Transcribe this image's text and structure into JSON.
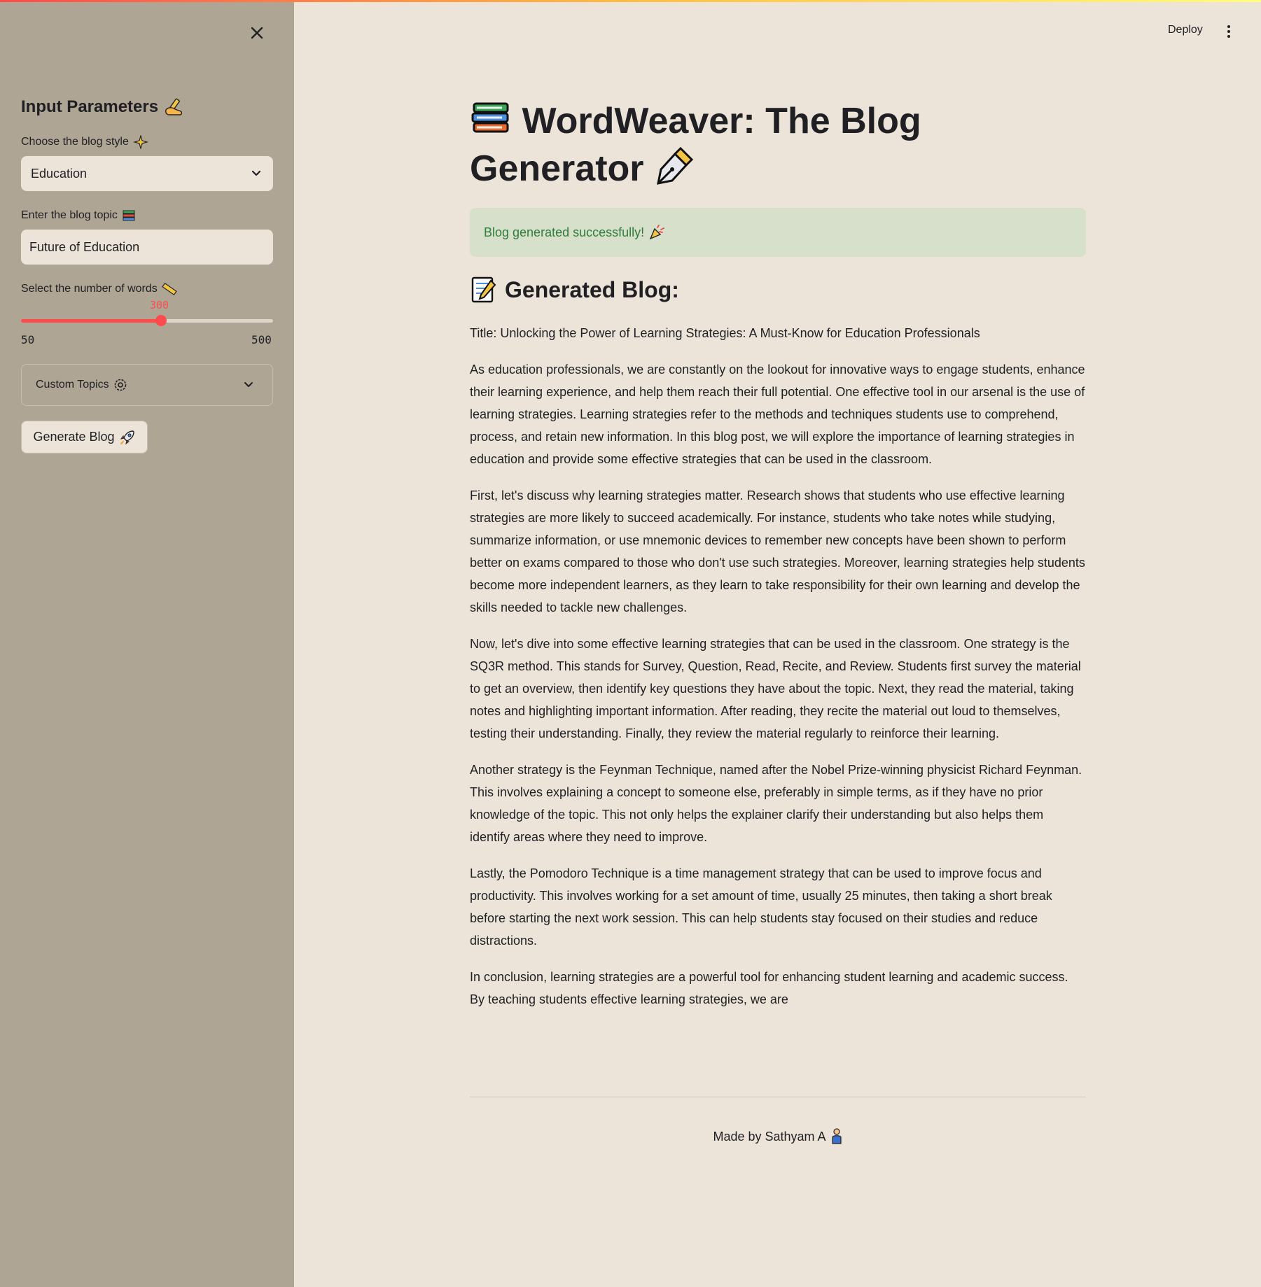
{
  "sidebar": {
    "title": "Input Parameters",
    "style_label": "Choose the blog style",
    "style_value": "Education",
    "topic_label": "Enter the blog topic",
    "topic_value": "Future of Education",
    "words_label": "Select the number of words",
    "words_value": "300",
    "words_min": "50",
    "words_max": "500",
    "custom_topics_label": "Custom Topics",
    "generate_label": "Generate Blog"
  },
  "header": {
    "deploy_label": "Deploy"
  },
  "main": {
    "title_part1": "WordWeaver: The Blog",
    "title_part2": "Generator",
    "success_message": "Blog generated successfully!",
    "section_heading": "Generated Blog:",
    "blog_title": "Title: Unlocking the Power of Learning Strategies: A Must-Know for Education Professionals",
    "paragraphs": [
      "As education professionals, we are constantly on the lookout for innovative ways to engage students, enhance their learning experience, and help them reach their full potential. One effective tool in our arsenal is the use of learning strategies. Learning strategies refer to the methods and techniques students use to comprehend, process, and retain new information. In this blog post, we will explore the importance of learning strategies in education and provide some effective strategies that can be used in the classroom.",
      "First, let's discuss why learning strategies matter. Research shows that students who use effective learning strategies are more likely to succeed academically. For instance, students who take notes while studying, summarize information, or use mnemonic devices to remember new concepts have been shown to perform better on exams compared to those who don't use such strategies. Moreover, learning strategies help students become more independent learners, as they learn to take responsibility for their own learning and develop the skills needed to tackle new challenges.",
      "Now, let's dive into some effective learning strategies that can be used in the classroom. One strategy is the SQ3R method. This stands for Survey, Question, Read, Recite, and Review. Students first survey the material to get an overview, then identify key questions they have about the topic. Next, they read the material, taking notes and highlighting important information. After reading, they recite the material out loud to themselves, testing their understanding. Finally, they review the material regularly to reinforce their learning.",
      "Another strategy is the Feynman Technique, named after the Nobel Prize-winning physicist Richard Feynman. This involves explaining a concept to someone else, preferably in simple terms, as if they have no prior knowledge of the topic. This not only helps the explainer clarify their understanding but also helps them identify areas where they need to improve.",
      "Lastly, the Pomodoro Technique is a time management strategy that can be used to improve focus and productivity. This involves working for a set amount of time, usually 25 minutes, then taking a short break before starting the next work session. This can help students stay focused on their studies and reduce distractions.",
      "In conclusion, learning strategies are a powerful tool for enhancing student learning and academic success. By teaching students effective learning strategies, we are"
    ],
    "footer_text": "Made by Sathyam A"
  },
  "colors": {
    "accent": "#ff4b4b",
    "sidebar_bg": "#aea594",
    "main_bg": "#ece4d8",
    "success_bg": "#d6e0cb",
    "success_text": "#2f7d3a"
  },
  "icons": {
    "close": "close-icon",
    "menu": "kebab-menu-icon",
    "title_prefix": "books-icon",
    "title_suffix": "fountain-pen-icon",
    "sidebar_title": "writing-hand-icon",
    "style": "sparkle-icon",
    "topic": "books-icon",
    "words": "ruler-icon",
    "custom_topics": "gear-icon",
    "generate": "rocket-icon",
    "success": "party-popper-icon",
    "section": "memo-icon",
    "footer": "person-icon"
  }
}
